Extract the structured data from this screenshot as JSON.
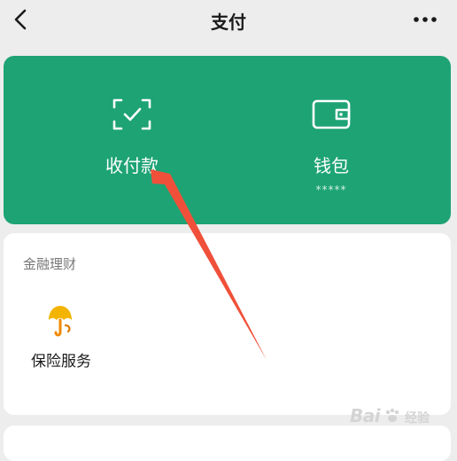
{
  "header": {
    "title": "支付",
    "back_icon": "chevron-left-icon",
    "more_icon": "more-dots-icon"
  },
  "pay_card": {
    "color": "#1ea375",
    "items": [
      {
        "label": "收付款",
        "icon": "scan-check-icon"
      },
      {
        "label": "钱包",
        "sub": "*****",
        "icon": "wallet-icon"
      }
    ]
  },
  "finance": {
    "section_title": "金融理财",
    "services": [
      {
        "label": "保险服务",
        "icon": "insurance-umbrella-icon"
      }
    ]
  },
  "annotation": {
    "color": "#f0503a"
  },
  "watermark": {
    "text": "Bai",
    "suffix": "经验"
  }
}
